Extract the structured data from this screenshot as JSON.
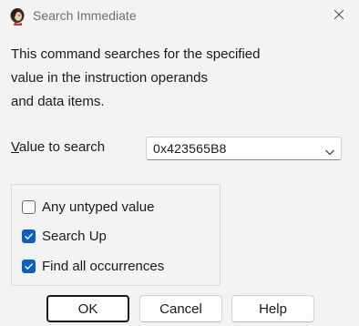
{
  "window": {
    "title": "Search Immediate",
    "app_icon": "ida-lady-icon",
    "close_icon": "close-icon"
  },
  "description": {
    "line1": "This command searches for the specified",
    "line2": "value in the instruction operands",
    "line3": "and data items."
  },
  "search": {
    "label_accel": "V",
    "label_rest": "alue to search",
    "value": "0x423565B8",
    "dropdown_icon": "chevron-down-icon"
  },
  "options": [
    {
      "label": "Any untyped value",
      "checked": false
    },
    {
      "label": "Search Up",
      "checked": true
    },
    {
      "label": "Find all occurrences",
      "checked": true
    }
  ],
  "buttons": {
    "ok": "OK",
    "cancel": "Cancel",
    "help": "Help"
  },
  "colors": {
    "accent": "#0a5fbf",
    "background": "#f3f3f3"
  }
}
